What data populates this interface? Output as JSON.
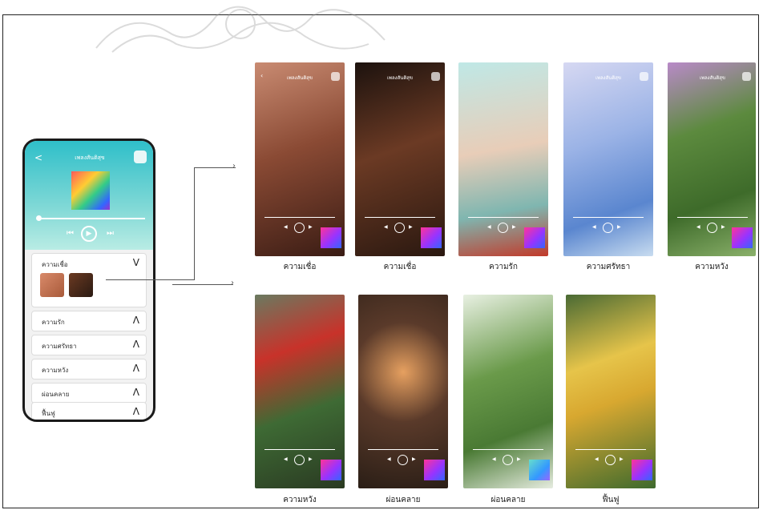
{
  "phone": {
    "header_title": "เพลงสันติสุข",
    "back_glyph": "<",
    "controls": {
      "prev": "⏮",
      "play": "▶",
      "next": "⏭"
    },
    "categories_open": {
      "label": "ความเชื่อ",
      "arrow": "V"
    },
    "categories": [
      {
        "label": "ความรัก",
        "arrow": "Λ"
      },
      {
        "label": "ความศรัทธา",
        "arrow": "Λ"
      },
      {
        "label": "ความหวัง",
        "arrow": "Λ"
      },
      {
        "label": "ผ่อนคลาย",
        "arrow": "Λ"
      },
      {
        "label": "ฟื้นฟู",
        "arrow": "Λ"
      }
    ]
  },
  "screens": [
    {
      "title": "เพลงสันติสุข",
      "caption": "ความเชื่อ"
    },
    {
      "title": "เพลงสันติสุข",
      "caption": "ความเชื่อ"
    },
    {
      "title": "",
      "caption": "ความรัก"
    },
    {
      "title": "เพลงสันติสุข",
      "caption": "ความศรัทธา"
    },
    {
      "title": "เพลงสันติสุข",
      "caption": "ความหวัง"
    },
    {
      "title": "",
      "caption": "ความหวัง"
    },
    {
      "title": "",
      "caption": "ผ่อนคลาย"
    },
    {
      "title": "",
      "caption": "ผ่อนคลาย"
    },
    {
      "title": "",
      "caption": "ฟื้นฟู"
    }
  ],
  "colors": {
    "player_teal": "#2fbfc9",
    "badge": "#9933ff"
  }
}
